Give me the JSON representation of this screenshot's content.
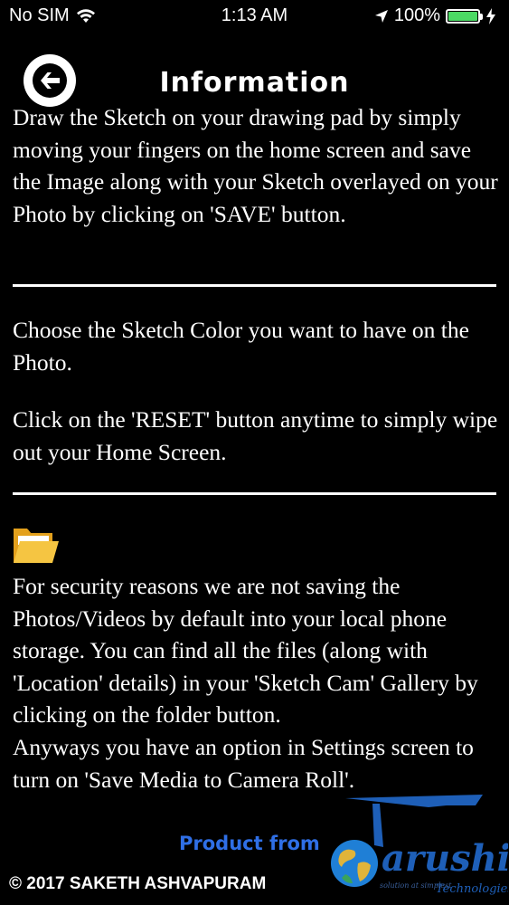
{
  "status": {
    "carrier": "No SIM",
    "time": "1:13 AM",
    "battery": "100%",
    "battery_level": 1.0
  },
  "header": {
    "title": "Information",
    "back_icon": "back-arrow-icon"
  },
  "content": {
    "para1": "Draw the Sketch on your drawing pad by simply moving your fingers on the home screen and save the Image along with your Sketch overlayed on your Photo by clicking on 'SAVE' button.",
    "para2": "Choose the Sketch Color you want to have on the Photo.",
    "para3": "Click on the 'RESET' button anytime to simply wipe out your Home Screen.",
    "folder_icon": "folder-icon",
    "para4": "For security reasons we are not saving the Photos/Videos by default into your local phone storage. You can find all the files (along with 'Location' details) in your 'Sketch Cam' Gallery by clicking on the folder button.",
    "para5": "Anyways you have an option in Settings screen to turn on 'Save Media to Camera Roll'."
  },
  "footer": {
    "product_from": "Product from",
    "copyright": "© 2017 SAKETH ASHVAPURAM",
    "logo_text": "arushi",
    "logo_subtext": "Technologies",
    "logo_tagline": "solution at simplest"
  },
  "colors": {
    "background": "#000000",
    "text": "#ffffff",
    "accent_blue": "#2f6fe6",
    "battery_green": "#4cd964",
    "folder_yellow": "#f5c542"
  }
}
